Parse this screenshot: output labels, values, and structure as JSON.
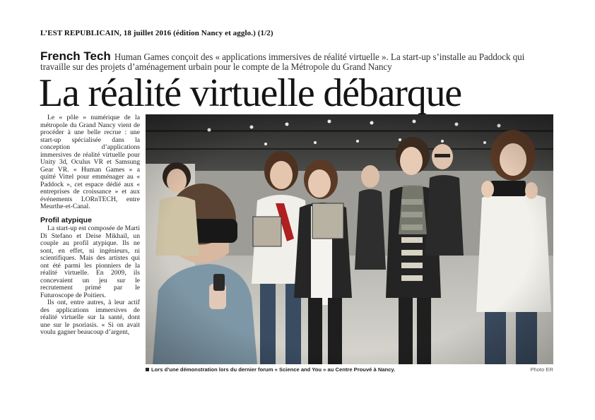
{
  "source_line": "L’EST REPUBLICAIN, 18 juillet 2016 (édition Nancy et agglo.) (1/2)",
  "kicker": {
    "rubric": "French Tech",
    "text": "Human Games conçoit des « applications immersives de réalité virtuelle ». La start-up s’installe au Paddock qui travaille sur des projets d’aménagement urbain pour le compte de la Métropole du Grand Nancy"
  },
  "headline": "La réalité virtuelle débarque",
  "body": {
    "paragraph_1": "Le « pôle » numérique de la métropole du Grand Nancy vient de procéder à une belle recrue : une start-up spécialisée dans la conception d’applications immersives de réalité virtuelle pour Unity 3d, Oculus VR et Samsung Gear VR. « Human Games » a quitté Vittel pour emménager au « Paddock », cet espace dédié aux « entreprises de croissance » et aux événements LORnTECH, entre Meurthe-et-Canal.",
    "subhead": "Profil atypique",
    "paragraph_2": "La start-up est composée de Marti Di Stefano et Deise Mikhail, un couple au profil atypique. Ils ne sont, en effet, ni ingénieurs, ni scientifiques. Mais des artistes qui ont été parmi les pionniers de la réalité virtuelle. En 2009, ils concevaient un jeu sur le recrutement primé par le Futuroscope de Poitiers.",
    "paragraph_3": "Ils ont, entre autres, à leur actif des applications immersives de réalité virtuelle sur la santé, dont une sur le psoriasis. « Si on avait voulu gagner beaucoup d’argent,"
  },
  "photo": {
    "caption": "Lors d’une démonstration lors du dernier forum « Science and You » au Centre Prouvé à Nancy.",
    "credit": "Photo ER"
  }
}
